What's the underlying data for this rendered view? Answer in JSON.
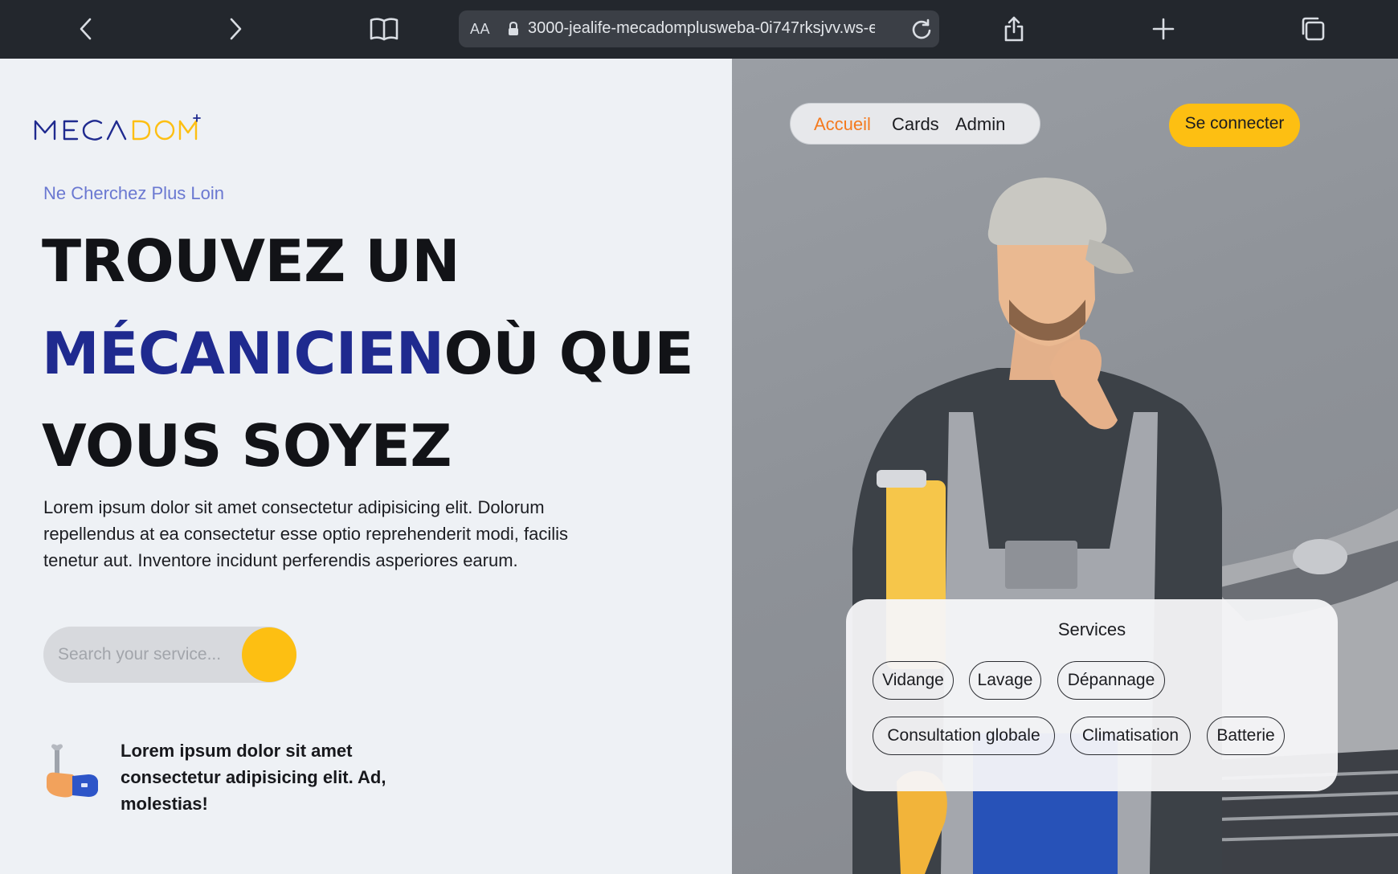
{
  "browser": {
    "text_size_label": "AA",
    "url": "3000-jealife-mecadomplusweba-0i747rksjvv.ws-eu"
  },
  "logo": {
    "text": "MECADOM",
    "superscript": "+",
    "colors": {
      "primary": "#1f2a8f",
      "secondary": "#fdbf12"
    }
  },
  "hero": {
    "tagline": "Ne Cherchez Plus Loin",
    "headline_line1": "TROUVEZ UN",
    "headline_accent": "MÉCANICIEN",
    "headline_line2_rest": "OÙ QUE",
    "headline_line3": "VOUS SOYEZ",
    "paragraph": "Lorem ipsum dolor sit amet consectetur adipisicing elit. Dolorum repellendus at ea consectetur esse optio reprehenderit modi, facilis tenetur aut. Inventore incidunt perferendis asperiores earum.",
    "search_placeholder": "Search your service...",
    "feature_text": "Lorem ipsum dolor sit amet consectetur adipisicing elit. Ad, molestias!",
    "feature_icon": "mechanic-hand-wrench-icon"
  },
  "nav": {
    "items": [
      {
        "label": "Accueil",
        "active": true
      },
      {
        "label": "Cards",
        "active": false
      },
      {
        "label": "Admin",
        "active": false
      }
    ],
    "login_label": "Se connecter"
  },
  "services": {
    "title": "Services",
    "chips": [
      "Vidange",
      "Lavage",
      "Dépannage",
      "Consultation globale",
      "Climatisation",
      "Batterie"
    ]
  },
  "colors": {
    "accent_yellow": "#fdbf12",
    "accent_blue": "#1f2a8f",
    "active_orange": "#f47a1f",
    "tagline_blue": "#6a78d1"
  }
}
